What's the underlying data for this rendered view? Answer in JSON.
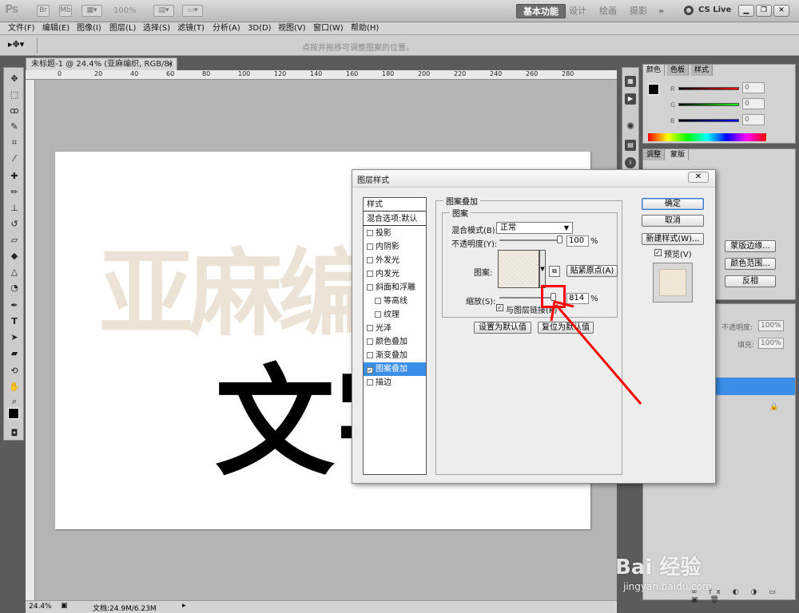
{
  "app": {
    "logo": "Ps",
    "zoom_select": "100%",
    "workspaces": [
      "基本功能",
      "设计",
      "绘画",
      "摄影"
    ],
    "more": "»",
    "cs_live": "CS Live"
  },
  "menu": [
    "文件(F)",
    "编辑(E)",
    "图像(I)",
    "图层(L)",
    "选择(S)",
    "滤镜(T)",
    "分析(A)",
    "3D(D)",
    "视图(V)",
    "窗口(W)",
    "帮助(H)"
  ],
  "options_bar": {
    "hint": "点按并拖移可调整图案的位置。"
  },
  "document": {
    "tab_title": "未标题-1 @ 24.4% (亚麻编织, RGB/8) *",
    "ruler_h": [
      "0",
      "20",
      "40",
      "60",
      "80",
      "100",
      "120",
      "140",
      "160",
      "180",
      "200",
      "220",
      "240",
      "260",
      "280"
    ],
    "canvas_text_1": "亚麻编织",
    "canvas_text_2": "文字",
    "status_zoom": "24.4%",
    "status_doc": "文档:24.9M/6.23M"
  },
  "right_panels": {
    "color_tabs": [
      "颜色",
      "色板",
      "样式"
    ],
    "rgb_labels": [
      "R",
      "G",
      "B"
    ],
    "rgb_values": [
      "0",
      "0",
      "0"
    ],
    "adjust_tabs": [
      "调整",
      "蒙版"
    ],
    "mask_buttons": [
      "蒙版边缘...",
      "颜色范围...",
      "反相"
    ],
    "layers_opacity_label": "不透明度:",
    "layers_opacity": "100%",
    "layers_fill_label": "填充:",
    "layers_fill": "100%"
  },
  "dialog": {
    "title": "图层样式",
    "close": "✕",
    "styles_header": "样式",
    "blend_options": "混合选项:默认",
    "style_items": [
      "投影",
      "内阴影",
      "外发光",
      "内发光",
      "斜面和浮雕",
      "等高线",
      "纹理",
      "光泽",
      "颜色叠加",
      "渐变叠加",
      "图案叠加",
      "描边"
    ],
    "checked_item": "图案叠加",
    "section_title": "图案叠加",
    "subsection_title": "图案",
    "blend_mode_label": "混合模式(B):",
    "blend_mode_value": "正常",
    "opacity_label": "不透明度(Y):",
    "opacity_value": "100",
    "percent": "%",
    "pattern_label": "图案:",
    "snap_origin": "贴紧原点(A)",
    "scale_label": "缩放(S):",
    "scale_value": "814",
    "link_with_layer": "与图层链接(K)",
    "set_default": "设置为默认值",
    "reset_default": "复位为默认值",
    "ok": "确定",
    "cancel": "取消",
    "new_style": "新建样式(W)...",
    "preview": "预览(V)",
    "opacity_fraction": 1.0
  },
  "watermark": {
    "brand": "Bai 经验",
    "url": "jingyan.baidu.com"
  },
  "colors": {
    "selection": "#3a8ee6",
    "highlight": "#ff0000"
  }
}
